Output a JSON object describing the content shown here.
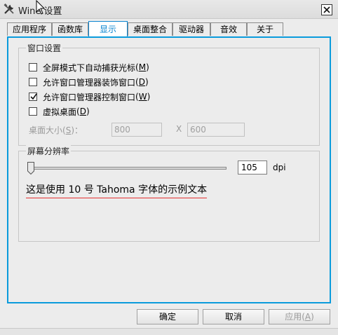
{
  "window": {
    "title": "Wine 设置"
  },
  "tabs": [
    {
      "label": "应用程序"
    },
    {
      "label": "函数库"
    },
    {
      "label": "显示"
    },
    {
      "label": "桌面整合"
    },
    {
      "label": "驱动器"
    },
    {
      "label": "音效"
    },
    {
      "label": "关于"
    }
  ],
  "active_tab": "显示",
  "window_settings": {
    "legend": "窗口设置",
    "options": [
      {
        "text": "全屏模式下自动捕获光标",
        "hotkey": "M",
        "checked": false
      },
      {
        "text": "允许窗口管理器装饰窗口",
        "hotkey": "D",
        "checked": false
      },
      {
        "text": "允许窗口管理器控制窗口",
        "hotkey": "W",
        "checked": true
      },
      {
        "text": "虚拟桌面",
        "hotkey": "D",
        "checked": false
      }
    ],
    "desktop_size": {
      "label": "桌面大小",
      "hotkey": "S",
      "width": "800",
      "separator": "X",
      "height": "600"
    }
  },
  "resolution": {
    "legend": "屏幕分辨率",
    "dpi_value": "105",
    "dpi_unit": "dpi",
    "slider_fraction": 0.0,
    "sample_text": "这是使用 10 号 Tahoma 字体的示例文本"
  },
  "buttons": {
    "ok": "确定",
    "cancel": "取消",
    "apply": "应用",
    "apply_hotkey": "A"
  },
  "colors": {
    "accent": "#0a9bdc",
    "sample_underline": "#e53030"
  },
  "icons": {
    "app": "wine-tools-icon",
    "close": "close-icon",
    "cursor": "mouse-cursor-icon"
  }
}
